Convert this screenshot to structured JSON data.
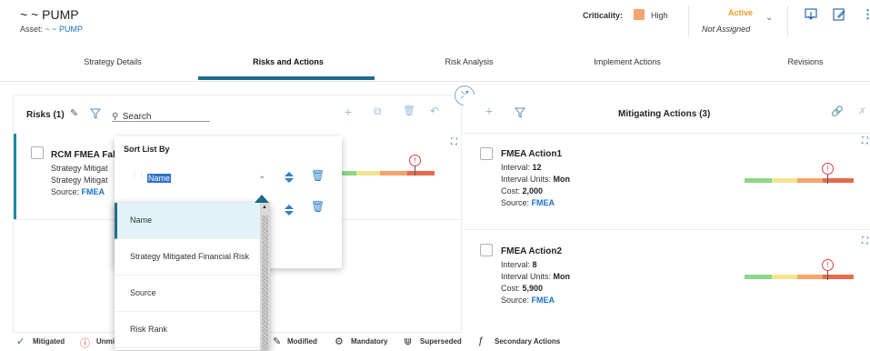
{
  "header": {
    "title": "~ ~ PUMP",
    "asset_label": "Asset:",
    "asset_value": "~ ~ PUMP",
    "criticality_label": "Criticality:",
    "criticality_value": "High",
    "criticality_color": "#f6a36c",
    "state": "Active",
    "assignee": "Not Assigned"
  },
  "tabs": [
    "Strategy Details",
    "Risks and Actions",
    "Risk Analysis",
    "Implement Actions",
    "Revisions"
  ],
  "active_tab": "Risks and Actions",
  "risks": {
    "title": "Risks (1)",
    "search_placeholder": "Search",
    "card": {
      "title": "RCM FMEA Fal",
      "line1": "Strategy Mitigat",
      "line2": "Strategy Mitigat",
      "source_label": "Source:",
      "source_value": "FMEA"
    }
  },
  "sort": {
    "title": "Sort List By",
    "selected": "Name",
    "options": [
      "Name",
      "Strategy Mitigated Financial Risk",
      "Source",
      "Risk Rank"
    ]
  },
  "actions": {
    "title": "Mitigating Actions (3)",
    "items": [
      {
        "title": "FMEA Action1",
        "interval_label": "Interval:",
        "interval": "12",
        "units_label": "Interval Units:",
        "units": "Mon",
        "cost_label": "Cost:",
        "cost": "2,000",
        "source_label": "Source:",
        "source": "FMEA"
      },
      {
        "title": "FMEA Action2",
        "interval_label": "Interval:",
        "interval": "8",
        "units_label": "Interval Units:",
        "units": "Mon",
        "cost_label": "Cost:",
        "cost": "5,900",
        "source_label": "Source:",
        "source": "FMEA"
      }
    ]
  },
  "risk_colors": {
    "green": "#8fd58a",
    "yellow": "#f2e58e",
    "orange": "#f6a36c",
    "red": "#e86a4e"
  },
  "legend": {
    "mitigated": "Mitigated",
    "unmitigated": "Unmi",
    "modified": "Modified",
    "mandatory": "Mandatory",
    "superseded": "Superseded",
    "secondary": "Secondary Actions"
  }
}
